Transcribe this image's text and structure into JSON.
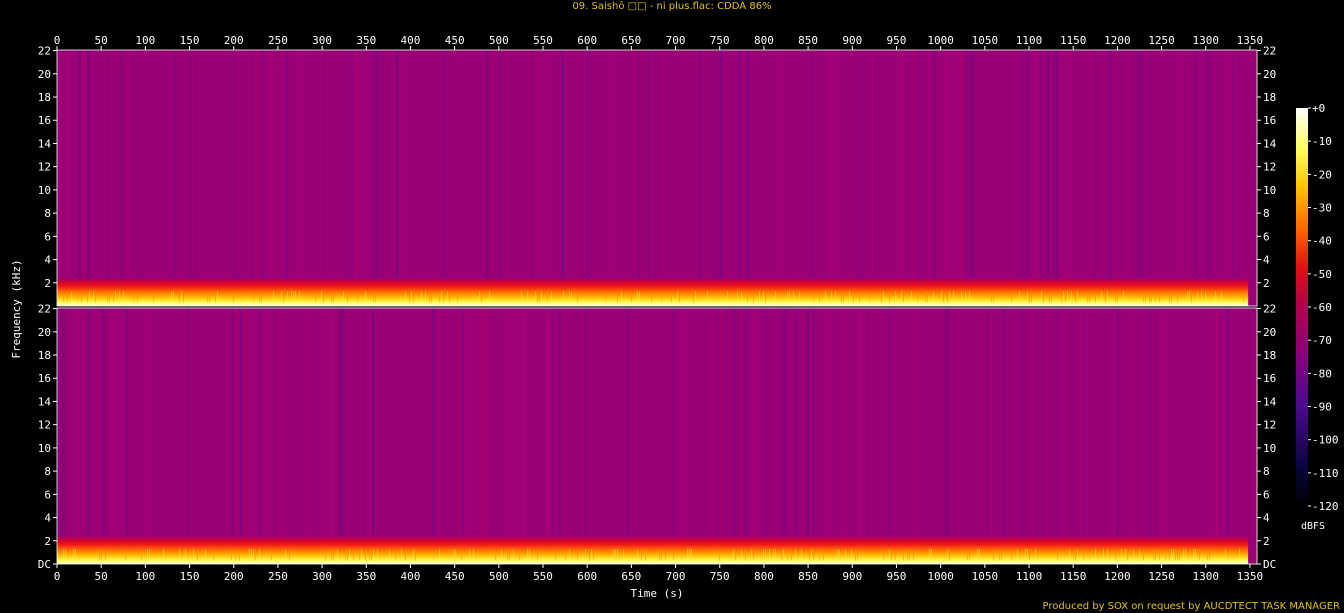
{
  "header": {
    "title": "09. Saishō □□ - ni plus.flac: CDDA 86%"
  },
  "footer": {
    "credit": "Produced by SOX on request by AUCDTECT TASK MANAGER"
  },
  "chart_data": {
    "type": "heatmap",
    "xlabel": "Time (s)",
    "ylabel": "Frequency (kHz)",
    "colorbar_label": "dBFS",
    "x_ticks": [
      0,
      50,
      100,
      150,
      200,
      250,
      300,
      350,
      400,
      450,
      500,
      550,
      600,
      650,
      700,
      750,
      800,
      850,
      900,
      950,
      1000,
      1050,
      1100,
      1150,
      1200,
      1250,
      1300,
      1350
    ],
    "xlim": [
      0,
      1358
    ],
    "signal_end_s": 1348,
    "channels": [
      {
        "y_ticks": [
          {
            "value": 2,
            "label": "2"
          },
          {
            "value": 4,
            "label": "4"
          },
          {
            "value": 6,
            "label": "6"
          },
          {
            "value": 8,
            "label": "8"
          },
          {
            "value": 10,
            "label": "10"
          },
          {
            "value": 12,
            "label": "12"
          },
          {
            "value": 14,
            "label": "14"
          },
          {
            "value": 16,
            "label": "16"
          },
          {
            "value": 18,
            "label": "18"
          },
          {
            "value": 20,
            "label": "20"
          },
          {
            "value": 22,
            "label": "22"
          }
        ]
      },
      {
        "y_ticks": [
          {
            "value": 0,
            "label": "DC"
          },
          {
            "value": 2,
            "label": "2"
          },
          {
            "value": 4,
            "label": "4"
          },
          {
            "value": 6,
            "label": "6"
          },
          {
            "value": 8,
            "label": "8"
          },
          {
            "value": 10,
            "label": "10"
          },
          {
            "value": 12,
            "label": "12"
          },
          {
            "value": 14,
            "label": "14"
          },
          {
            "value": 16,
            "label": "16"
          },
          {
            "value": 18,
            "label": "18"
          },
          {
            "value": 20,
            "label": "20"
          },
          {
            "value": 22,
            "label": "22"
          }
        ]
      }
    ],
    "ylim": [
      0,
      22.05
    ],
    "colorbar_ticks": [
      {
        "value": 0,
        "label": "+0"
      },
      {
        "value": -10,
        "label": "-10"
      },
      {
        "value": -20,
        "label": "-20"
      },
      {
        "value": -30,
        "label": "-30"
      },
      {
        "value": -40,
        "label": "-40"
      },
      {
        "value": -50,
        "label": "-50"
      },
      {
        "value": -60,
        "label": "-60"
      },
      {
        "value": -70,
        "label": "-70"
      },
      {
        "value": -80,
        "label": "-80"
      },
      {
        "value": -90,
        "label": "-90"
      },
      {
        "value": -100,
        "label": "-100"
      },
      {
        "value": -110,
        "label": "-110"
      },
      {
        "value": -120,
        "label": "-120"
      }
    ],
    "colorbar_range": [
      -120,
      0
    ],
    "colors": {
      "background": "#000000",
      "text": "#ffffff",
      "title": "#e0c020",
      "dominant": "#9c0077",
      "stops": [
        "#000000",
        "#0a0540",
        "#4a0a90",
        "#8a007e",
        "#b00050",
        "#e01010",
        "#ff6a00",
        "#ffc000",
        "#ffff60",
        "#ffffff"
      ]
    }
  }
}
